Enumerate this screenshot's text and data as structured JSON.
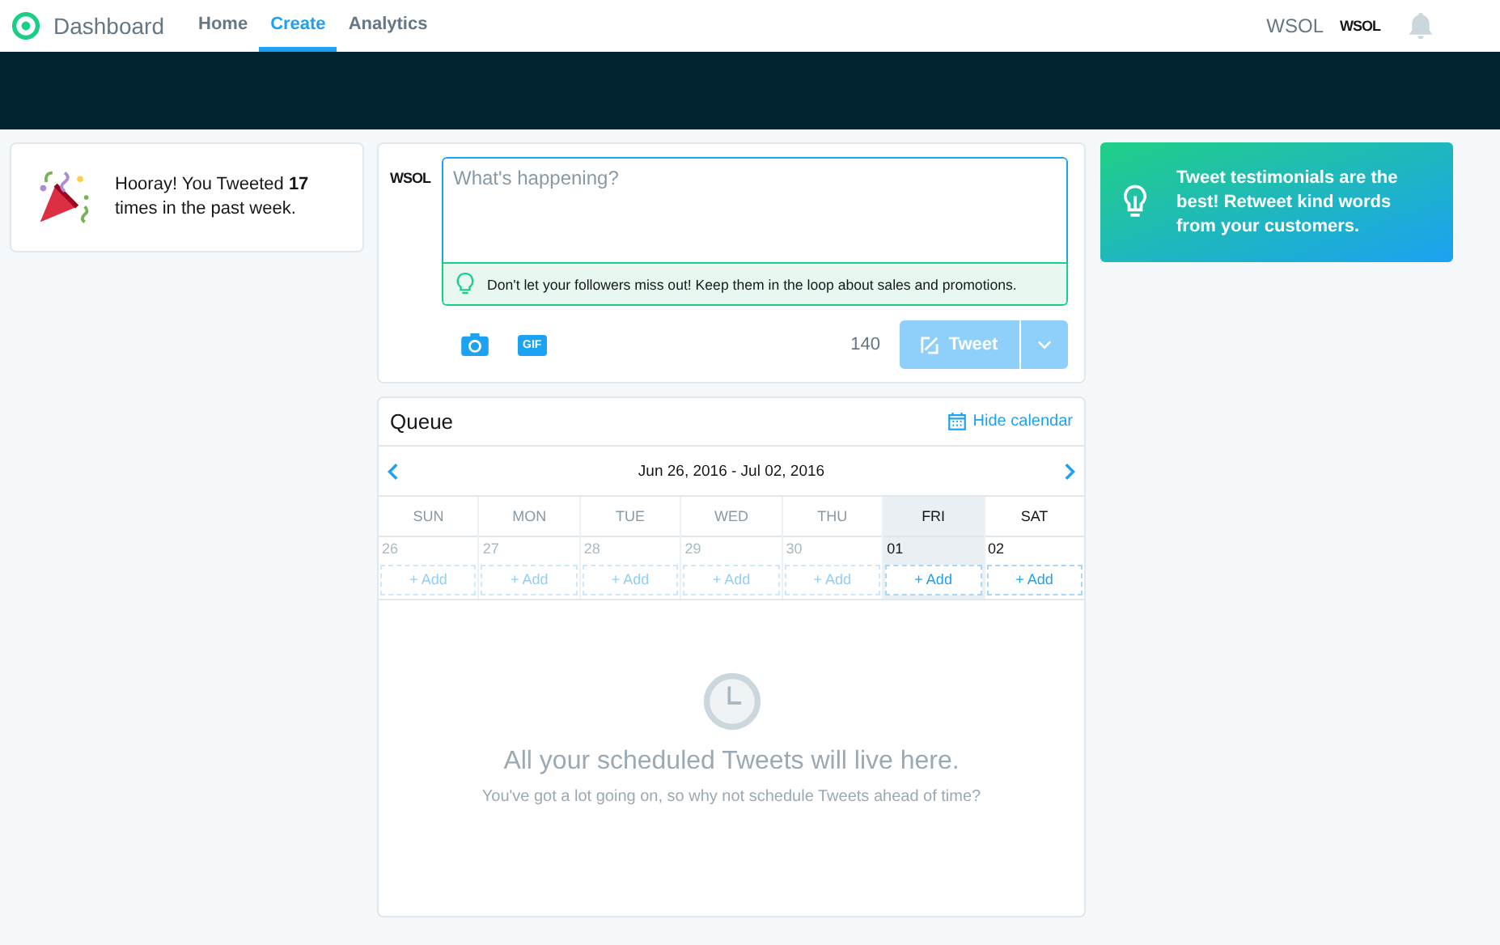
{
  "header": {
    "brand": "Dashboard",
    "nav": [
      {
        "label": "Home",
        "selected": false
      },
      {
        "label": "Create",
        "selected": true
      },
      {
        "label": "Analytics",
        "selected": false
      }
    ],
    "account": "WSOL",
    "account_logo": "WSOL"
  },
  "achievement": {
    "text": "Hooray! You Tweeted **17** times in the past week."
  },
  "composer": {
    "avatar_logo": "WSOL",
    "placeholder": "What's happening?",
    "tip": "Don't let your followers miss out! Keep them in the loop about sales and promotions.",
    "media": [
      "GIF"
    ],
    "count": "140",
    "tweet_button": {
      "label": "Tweet",
      "disabled": true
    }
  },
  "queue": {
    "title": "Queue",
    "toggle": "Hide calendar",
    "range": "Jun 26, 2016 - Jul 02, 2016",
    "days": [
      {
        "day": "SUN",
        "date": "26",
        "selected": false,
        "disabled": true,
        "add": "+ Add"
      },
      {
        "day": "MON",
        "date": "27",
        "selected": false,
        "disabled": true,
        "add": "+ Add"
      },
      {
        "day": "TUE",
        "date": "28",
        "selected": false,
        "disabled": true,
        "add": "+ Add"
      },
      {
        "day": "WED",
        "date": "29",
        "selected": false,
        "disabled": true,
        "add": "+ Add"
      },
      {
        "day": "THU",
        "date": "30",
        "selected": false,
        "disabled": true,
        "add": "+ Add"
      },
      {
        "day": "FRI",
        "date": "01",
        "selected": true,
        "disabled": false,
        "add": "+ Add"
      },
      {
        "day": "SAT",
        "date": "02",
        "selected": false,
        "disabled": false,
        "add": "+ Add"
      }
    ],
    "empty_title": "All your scheduled Tweets will live here.",
    "empty_text": "You've got a lot going on, so why not schedule Tweets ahead of time?"
  },
  "promo": {
    "text": "Tweet testimonials are the best! Retweet kind words from your customers."
  }
}
